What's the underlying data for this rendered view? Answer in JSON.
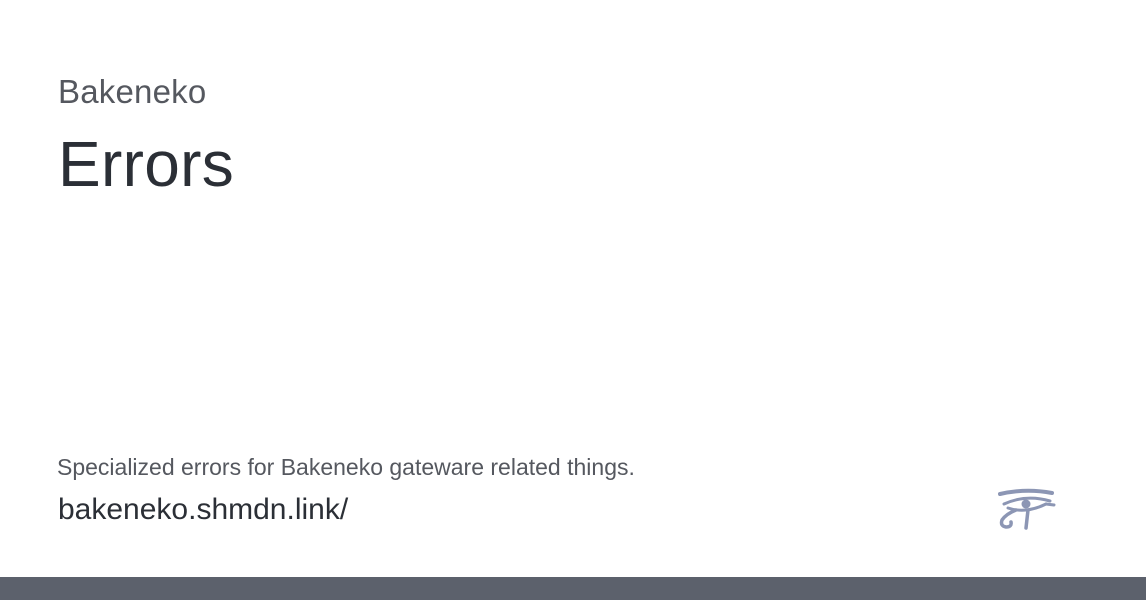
{
  "card": {
    "site_name": "Bakeneko",
    "title": "Errors",
    "description": "Specialized errors for Bakeneko gateware related things.",
    "url": "bakeneko.shmdn.link/"
  },
  "logo": {
    "icon": "eye-of-horus-icon",
    "color": "#8c96b4"
  },
  "footer": {
    "color": "#5c616c"
  }
}
